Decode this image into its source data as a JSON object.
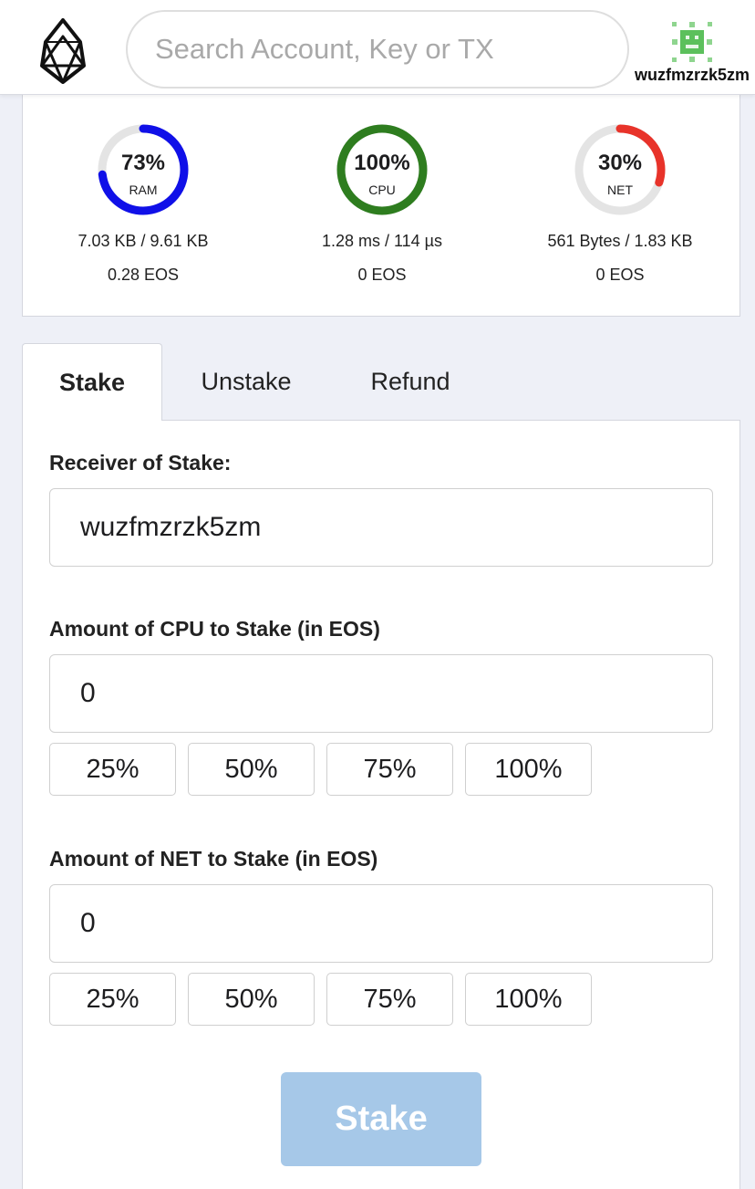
{
  "header": {
    "search_placeholder": "Search Account, Key or TX",
    "account_name": "wuzfmzrzk5zm"
  },
  "resources": [
    {
      "name": "RAM",
      "percent_label": "73%",
      "percent": 73,
      "usage": "7.03 KB / 9.61 KB",
      "staked": "0.28 EOS",
      "color": "#1010e8"
    },
    {
      "name": "CPU",
      "percent_label": "100%",
      "percent": 100,
      "usage": "1.28 ms / 114 µs",
      "staked": "0 EOS",
      "color": "#2e7d1f"
    },
    {
      "name": "NET",
      "percent_label": "30%",
      "percent": 30,
      "usage": "561 Bytes / 1.83 KB",
      "staked": "0 EOS",
      "color": "#e8332a"
    }
  ],
  "tabs": [
    {
      "label": "Stake",
      "active": true
    },
    {
      "label": "Unstake",
      "active": false
    },
    {
      "label": "Refund",
      "active": false
    }
  ],
  "form": {
    "receiver_label": "Receiver of Stake:",
    "receiver_value": "wuzfmzrzk5zm",
    "cpu_label": "Amount of CPU to Stake (in EOS)",
    "cpu_value": "0",
    "net_label": "Amount of NET to Stake (in EOS)",
    "net_value": "0",
    "percent_options": [
      "25%",
      "50%",
      "75%",
      "100%"
    ],
    "submit_label": "Stake"
  },
  "colors": {
    "accent_disabled": "#a6c8e8",
    "gauge_track": "#e4e4e4"
  }
}
